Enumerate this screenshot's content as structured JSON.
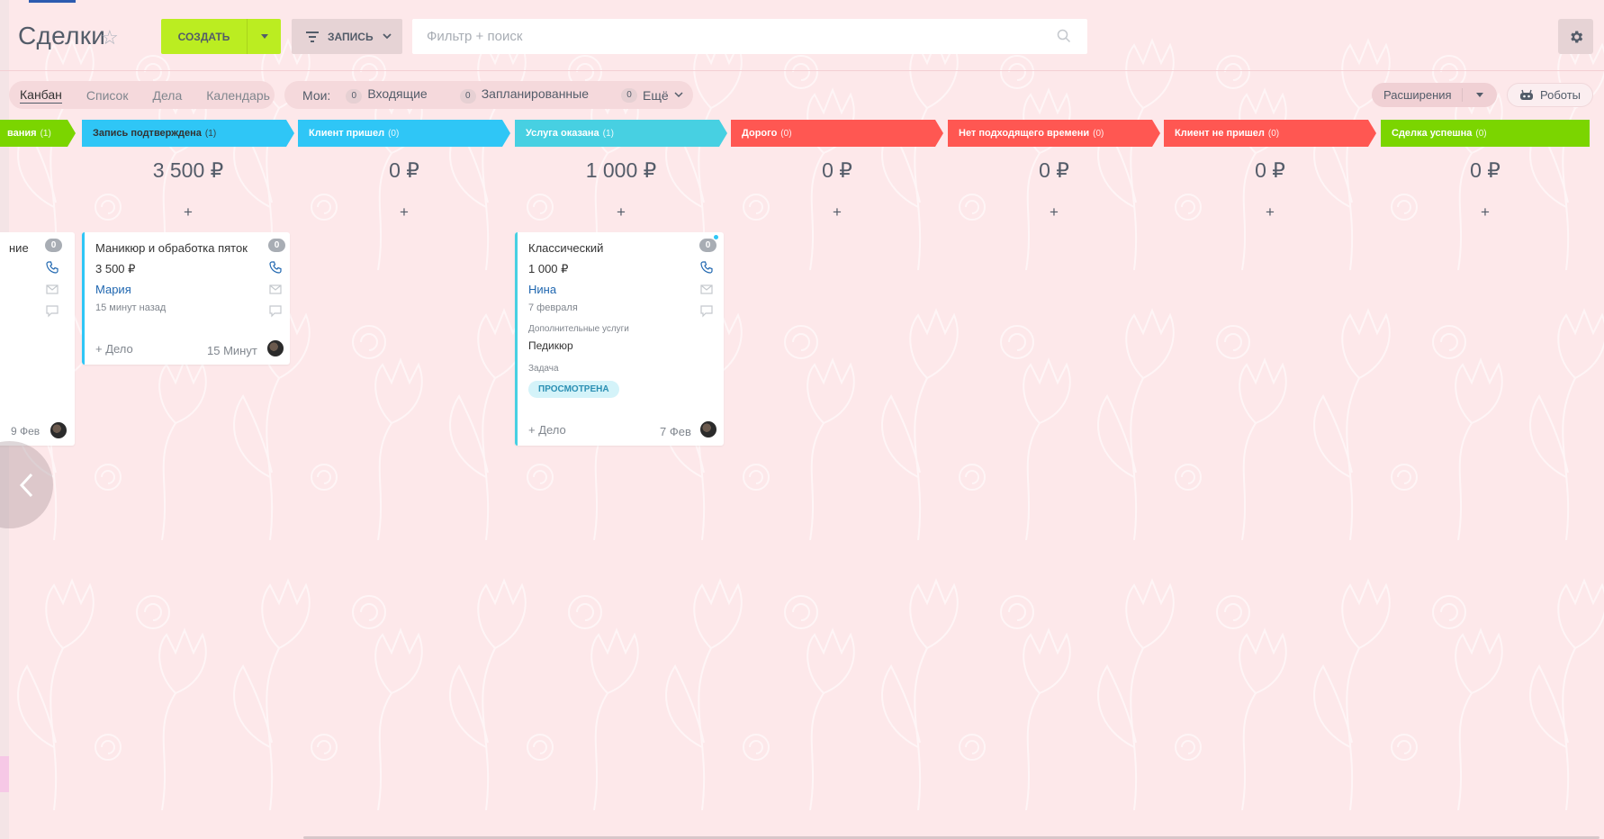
{
  "header": {
    "title": "Сделки",
    "create_label": "СОЗДАТЬ",
    "filter_label": "ЗАПИСЬ",
    "search_placeholder": "Фильтр + поиск"
  },
  "views": {
    "items": [
      "Канбан",
      "Список",
      "Дела",
      "Календарь"
    ],
    "active": "Канбан"
  },
  "counters": {
    "label": "Мои:",
    "items": [
      {
        "count": "0",
        "label": "Входящие"
      },
      {
        "count": "0",
        "label": "Запланированные"
      },
      {
        "count": "0",
        "label": "Ещё"
      }
    ]
  },
  "toolbar_right": {
    "extensions_label": "Расширения",
    "robots_label": "Роботы"
  },
  "colors": {
    "green": "#7bd500",
    "blue": "#2fc6f6",
    "cyan": "#47d0e2",
    "red": "#ff5752",
    "create": "#bbed21"
  },
  "stages": [
    {
      "name": "вания",
      "count": "(1)",
      "sum": "",
      "color": "#7bd500"
    },
    {
      "name": "Запись подтверждена",
      "count": "(1)",
      "sum": "3 500 ₽",
      "color": "#2fc6f6"
    },
    {
      "name": "Клиент пришел",
      "count": "(0)",
      "sum": "0 ₽",
      "color": "#2fc6f6"
    },
    {
      "name": "Услуга оказана",
      "count": "(1)",
      "sum": "1 000 ₽",
      "color": "#47d0e2"
    },
    {
      "name": "Дорого",
      "count": "(0)",
      "sum": "0 ₽",
      "color": "#ff5752"
    },
    {
      "name": "Нет подходящего времени",
      "count": "(0)",
      "sum": "0 ₽",
      "color": "#ff5752"
    },
    {
      "name": "Клиент не пришел",
      "count": "(0)",
      "sum": "0 ₽",
      "color": "#ff5752"
    },
    {
      "name": "Сделка успешна",
      "count": "(0)",
      "sum": "0 ₽",
      "color": "#7bd500"
    }
  ],
  "cards": {
    "partial": {
      "title": "ние",
      "badge": "0",
      "when": "9 Фев"
    },
    "manicure": {
      "title": "Маникюр и обработка пяток",
      "price": "3 500 ₽",
      "client": "Мария",
      "date": "15 минут назад",
      "badge": "0",
      "add_task": "+ Дело",
      "when": "15 Минут"
    },
    "classic": {
      "title": "Классический",
      "price": "1 000 ₽",
      "client": "Нина",
      "date": "7 февраля",
      "badge": "0",
      "extra_label": "Дополнительные услуги",
      "extra_value": "Педикюр",
      "task_label": "Задача",
      "task_status": "ПРОСМОТРЕНА",
      "add_task": "+ Дело",
      "when": "7 Фев"
    }
  }
}
